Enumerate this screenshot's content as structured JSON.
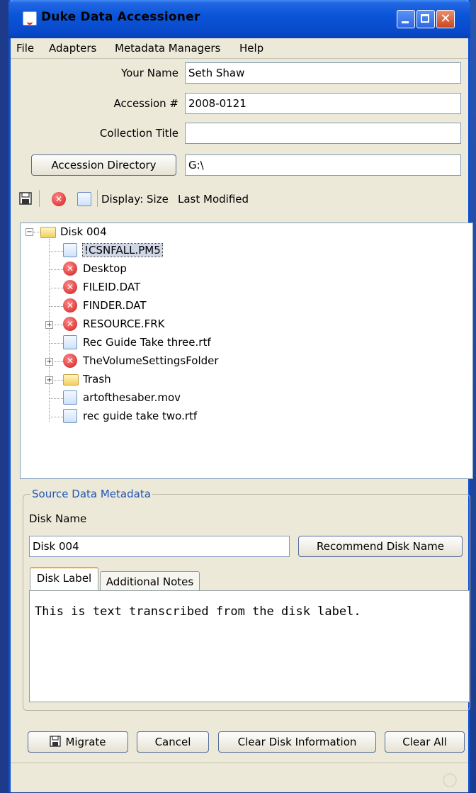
{
  "window": {
    "title": "Duke Data Accessioner"
  },
  "menu": [
    "File",
    "Adapters",
    "Metadata Managers",
    "Help"
  ],
  "form": {
    "your_name_label": "Your Name",
    "your_name_value": "Seth Shaw",
    "accession_label": "Accession #",
    "accession_value": "2008-0121",
    "collection_title_label": "Collection Title",
    "collection_title_value": "",
    "accession_dir_button": "Accession Directory",
    "accession_dir_value": "G:\\"
  },
  "toolbar": {
    "display_label": "Display:",
    "display_size": "Size",
    "display_last_modified": "Last Modified",
    "icons": [
      "save-icon",
      "error-icon",
      "file-icon"
    ]
  },
  "tree": {
    "root": "Disk 004",
    "items": [
      {
        "label": "!CSNFALL.PM5",
        "icon": "file",
        "expandable": false,
        "selected": true
      },
      {
        "label": "Desktop",
        "icon": "error",
        "expandable": false
      },
      {
        "label": "FILEID.DAT",
        "icon": "error",
        "expandable": false
      },
      {
        "label": "FINDER.DAT",
        "icon": "error",
        "expandable": false
      },
      {
        "label": "RESOURCE.FRK",
        "icon": "error",
        "expandable": true
      },
      {
        "label": "Rec Guide Take three.rtf",
        "icon": "file",
        "expandable": false
      },
      {
        "label": "TheVolumeSettingsFolder",
        "icon": "error",
        "expandable": true
      },
      {
        "label": "Trash",
        "icon": "folder",
        "expandable": true
      },
      {
        "label": "artofthesaber.mov",
        "icon": "file",
        "expandable": false
      },
      {
        "label": "rec guide take two.rtf",
        "icon": "file",
        "expandable": false
      }
    ]
  },
  "metadata": {
    "group_title": "Source Data Metadata",
    "disk_name_label": "Disk Name",
    "disk_name_value": "Disk 004",
    "recommend_button": "Recommend Disk Name",
    "tabs": [
      "Disk Label",
      "Additional Notes"
    ],
    "disk_label_text": "This is text transcribed from the disk label."
  },
  "actions": {
    "migrate": "Migrate",
    "cancel": "Cancel",
    "clear_disk": "Clear Disk Information",
    "clear_all": "Clear All"
  }
}
